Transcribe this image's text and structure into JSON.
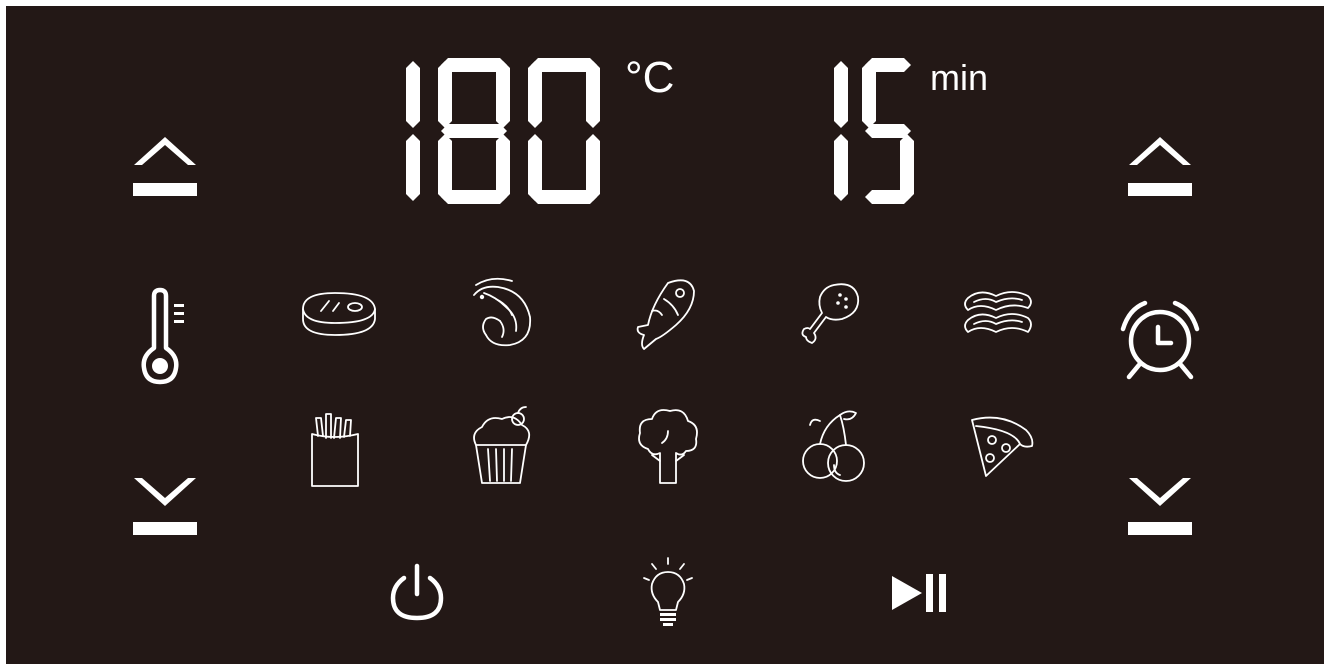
{
  "display": {
    "temperature": "180",
    "temperature_unit": "°C",
    "time": "15",
    "time_unit": "min"
  },
  "controls": {
    "temp_up": "chevron-up-icon",
    "temp_down": "chevron-down-icon",
    "time_up": "chevron-up-icon",
    "time_down": "chevron-down-icon",
    "temperature_icon": "thermometer-icon",
    "timer_icon": "alarm-clock-icon",
    "power": "power-icon",
    "light": "light-bulb-icon",
    "start_pause": "play-pause-icon"
  },
  "presets": [
    {
      "icon": "steak-icon"
    },
    {
      "icon": "shrimp-icon"
    },
    {
      "icon": "fish-icon"
    },
    {
      "icon": "chicken-leg-icon"
    },
    {
      "icon": "bacon-icon"
    },
    {
      "icon": "fries-icon"
    },
    {
      "icon": "cupcake-icon"
    },
    {
      "icon": "broccoli-icon"
    },
    {
      "icon": "cherries-icon"
    },
    {
      "icon": "pizza-icon"
    }
  ],
  "colors": {
    "panel": "#231816",
    "foreground": "#ffffff"
  }
}
